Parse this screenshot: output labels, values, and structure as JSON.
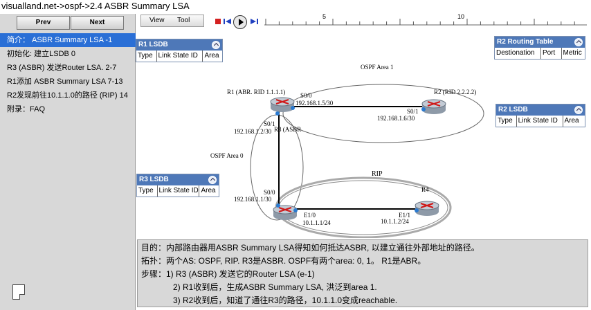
{
  "title": "visualland.net->ospf->2.4 ASBR Summary LSA",
  "nav": {
    "prev_label": "Prev",
    "next_label": "Next"
  },
  "steps": [
    "简介： ASBR Summary LSA -1",
    "初始化: 建立LSDB 0",
    "R3 (ASBR) 发送Router LSA. 2-7",
    "R1添加 ASBR Summary LSA 7-13",
    "R2发现前往10.1.1.0的路径 (RIP) 14",
    "附录：FAQ"
  ],
  "menu": {
    "view_label": "View",
    "tool_label": "Tool"
  },
  "timeline": {
    "ticks": [
      "5",
      "10"
    ]
  },
  "panels": {
    "r1_lsdb": {
      "title": "R1 LSDB",
      "cols": [
        "Type",
        "Link State ID",
        "Area"
      ]
    },
    "r2_routing": {
      "title": "R2 Routing Table",
      "cols": [
        "Destionation",
        "Port",
        "Metric"
      ]
    },
    "r2_lsdb": {
      "title": "R2 LSDB",
      "cols": [
        "Type",
        "Link State ID",
        "Area"
      ]
    },
    "r3_lsdb": {
      "title": "R3 LSDB",
      "cols": [
        "Type",
        "Link State ID",
        "Area"
      ]
    }
  },
  "diagram": {
    "area1_label": "OSPF Area 1",
    "area0_label": "OSPF Area 0",
    "rip_label": "RIP",
    "r1_label": "R1 (ABR. RID 1.1.1.1)",
    "r2_label": "R2 (RID 2.2.2.2)",
    "r3_label": "R3 (ASBR",
    "r4_label": "R4",
    "r1_s00": "S0/0",
    "r1_s00_ip": "192.168.1.5/30",
    "r2_s01": "S0/1",
    "r2_s01_ip": "192.168.1.6/30",
    "r1_s01": "S0/1",
    "r1_s01_ip": "192.168.1.2/30",
    "r3_s00": "S0/0",
    "r3_s00_ip": "192.168.1.1/30",
    "r3_e10": "E1/0",
    "r3_e10_ip": "10.1.1.1/24",
    "r4_e11": "E1/1",
    "r4_e11_ip": "10.1.1.2/24"
  },
  "description": {
    "line1": "目的：内部路由器用ASBR Summary LSA得知如何抵达ASBR, 以建立通往外部地址的路径。",
    "line2": "拓扑：两个AS: OSPF, RIP. R3是ASBR. OSPF有两个area: 0, 1。 R1是ABR。",
    "line3": "步骤：1) R3 (ASBR) 发送它的Router LSA (e-1)",
    "line4": "2) R1收到后，生成ASBR Summary LSA, 洪泛到area 1.",
    "line5": "3) R2收到后，知道了通往R3的路径，10.1.1.0变成reachable."
  },
  "colors": {
    "accent": "#2a6fd6",
    "panel_header": "#4e78b8",
    "stop": "#d42020",
    "step_blue": "#2040c0"
  }
}
